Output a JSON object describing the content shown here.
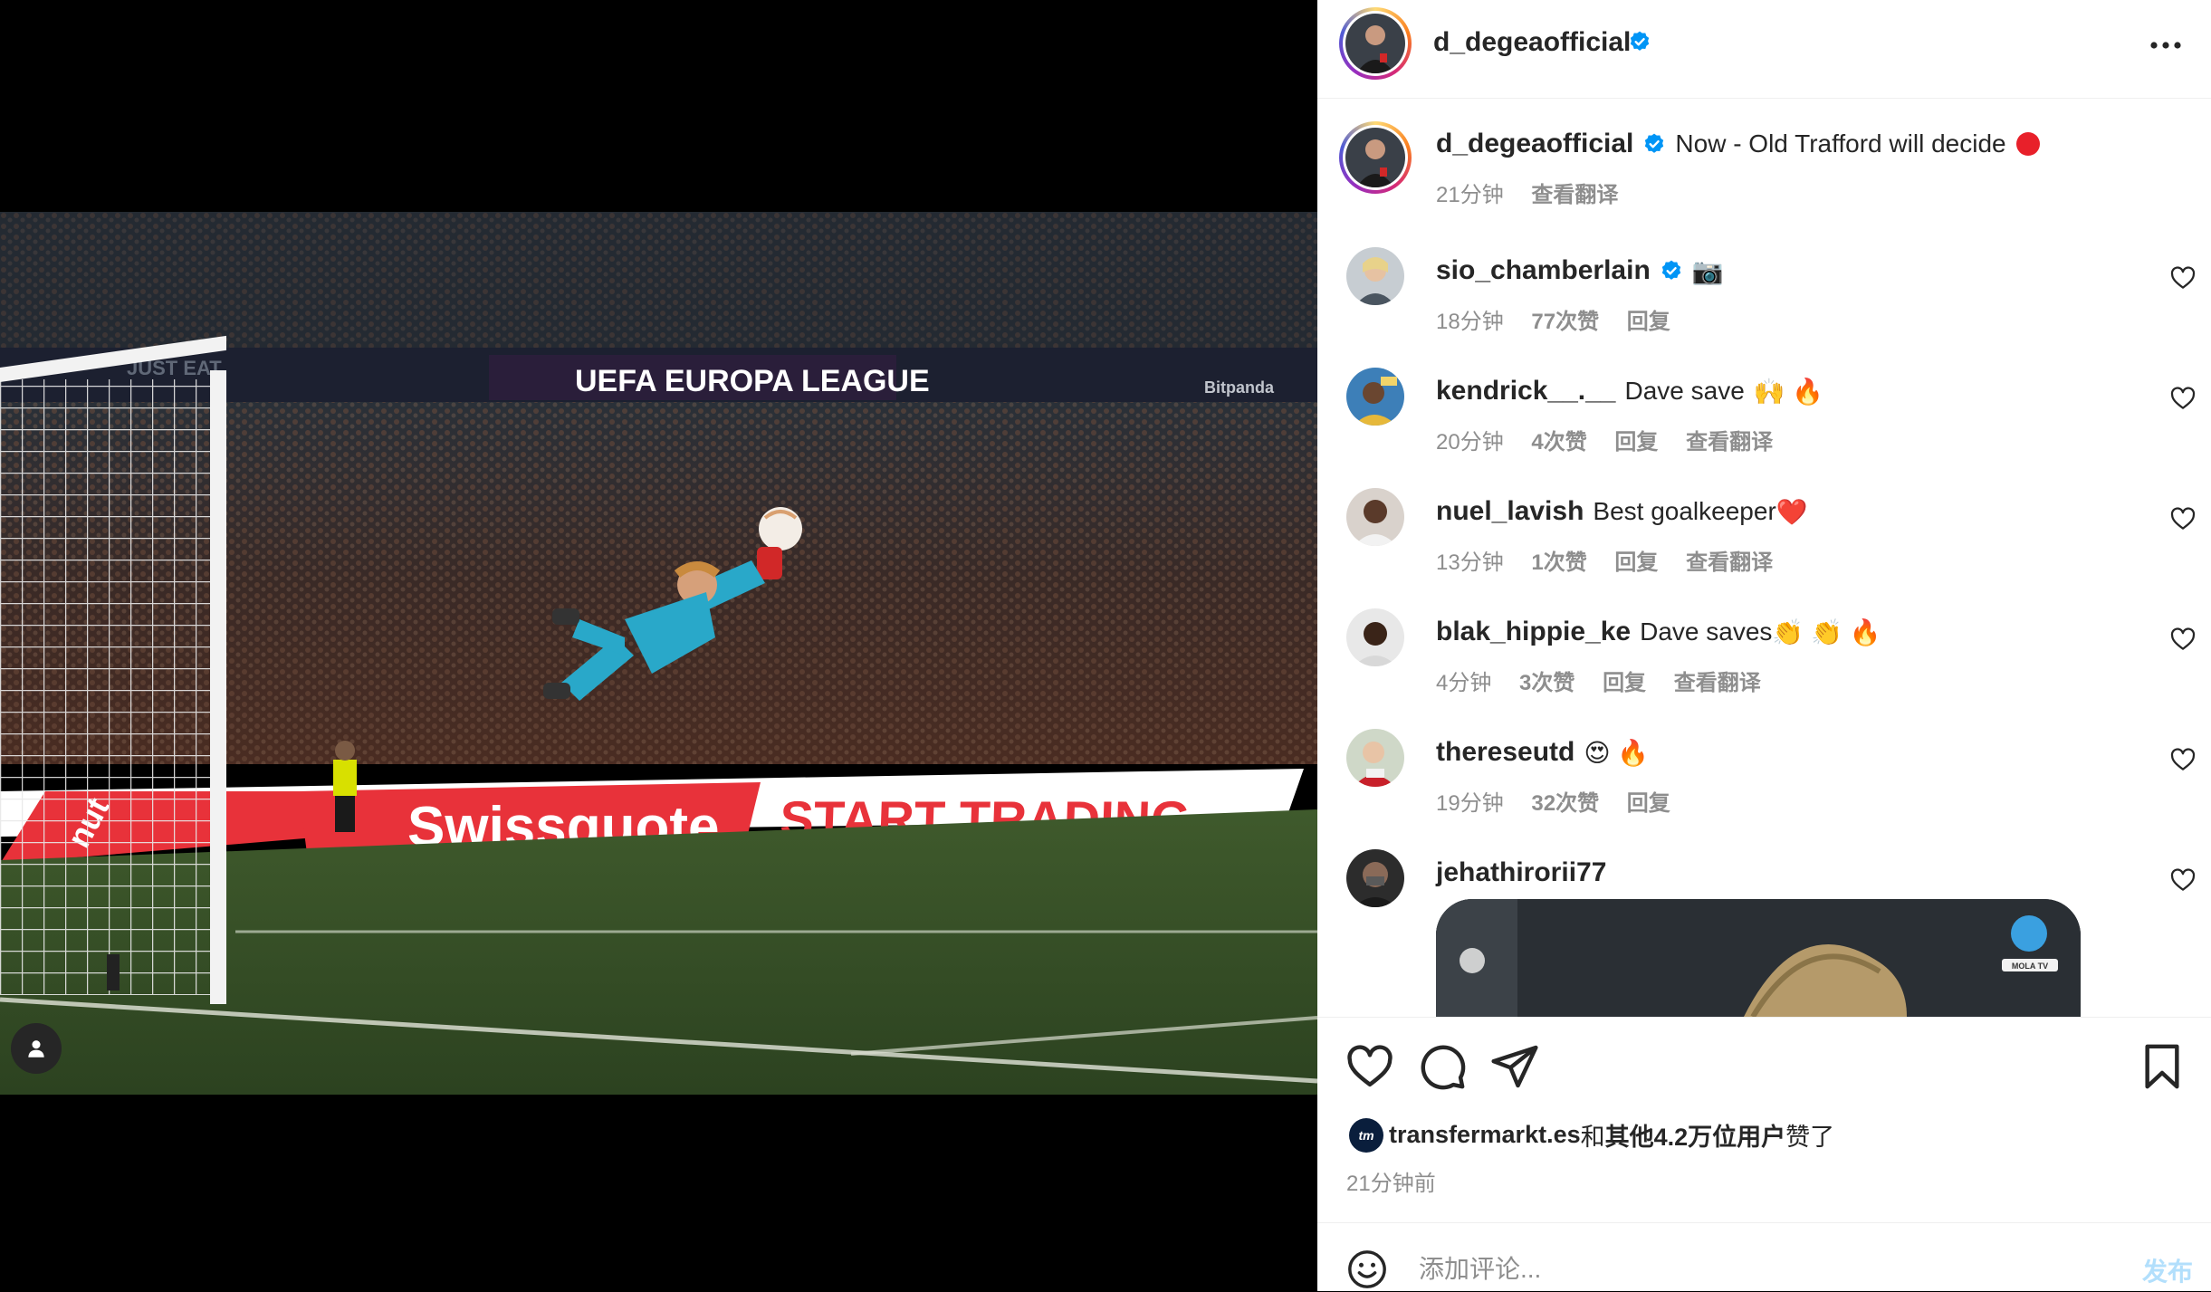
{
  "post": {
    "author": "d_degeaofficial",
    "caption": "Now - Old Trafford will decide",
    "caption_emoji": "red-circle",
    "time": "21分钟",
    "translate": "查看翻译"
  },
  "photo": {
    "banner_league": "UEFA EUROPA LEAGUE",
    "banner_sponsor": "Swissquote",
    "banner_cta": "START TRADING",
    "banner_left": "JUST EAT",
    "banner_right": "Bitpanda",
    "banner_partial": "nut"
  },
  "comments": [
    {
      "username": "sio_chamberlain",
      "verified": true,
      "text": "",
      "emoji": "📷",
      "time": "18分钟",
      "likes": "77次赞",
      "reply": "回复",
      "translate": ""
    },
    {
      "username": "kendrick__.__",
      "verified": false,
      "text": "Dave save",
      "emoji": "🙌 🔥",
      "time": "20分钟",
      "likes": "4次赞",
      "reply": "回复",
      "translate": "查看翻译"
    },
    {
      "username": "nuel_lavish",
      "verified": false,
      "text": "Best goalkeeper",
      "emoji": "❤️",
      "time": "13分钟",
      "likes": "1次赞",
      "reply": "回复",
      "translate": "查看翻译"
    },
    {
      "username": "blak_hippie_ke",
      "verified": false,
      "text": "Dave saves",
      "emoji": "👏 👏 🔥",
      "time": "4分钟",
      "likes": "3次赞",
      "reply": "回复",
      "translate": "查看翻译"
    },
    {
      "username": "thereseutd",
      "verified": false,
      "text": "",
      "emoji": "😍 🔥",
      "time": "19分钟",
      "likes": "32次赞",
      "reply": "回复",
      "translate": ""
    },
    {
      "username": "jehathirorii77",
      "verified": false,
      "text": "",
      "emoji": "",
      "time": "",
      "likes": "",
      "reply": "",
      "translate": ""
    }
  ],
  "media_preview": {
    "watermark": "MOLA TV"
  },
  "likes": {
    "liker": "transfermarkt.es",
    "connector": "和",
    "others": "其他4.2万位用户",
    "suffix": "赞了",
    "logo_text": "tm"
  },
  "posted_time": "21分钟前",
  "comment_box": {
    "placeholder": "添加评论...",
    "post_label": "发布"
  },
  "icons": {
    "header_more": "more-horizontal-icon",
    "verified": "verified-badge-icon",
    "like": "heart-icon",
    "comment": "comment-icon",
    "share": "send-icon",
    "save": "bookmark-icon",
    "emoji": "smiley-icon",
    "tag": "user-tag-icon"
  },
  "colors": {
    "verified": "#0095f6",
    "post_button": "#b2dffc",
    "secondary_text": "#8e8e8e",
    "primary_text": "#262626"
  }
}
